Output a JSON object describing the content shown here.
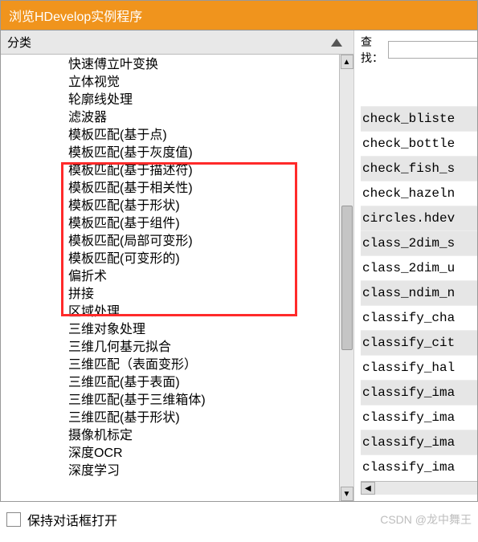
{
  "titlebar": {
    "title": "浏览HDevelop实例程序"
  },
  "left": {
    "header": "分类",
    "items": [
      "快速傅立叶变换",
      "立体视觉",
      "轮廓线处理",
      "滤波器",
      "模板匹配(基于点)",
      "模板匹配(基于灰度值)",
      "模板匹配(基于描述符)",
      "模板匹配(基于相关性)",
      "模板匹配(基于形状)",
      "模板匹配(基于组件)",
      "模板匹配(局部可变形)",
      "模板匹配(可变形的)",
      "偏折术",
      "拼接",
      "区域处理",
      "三维对象处理",
      "三维几何基元拟合",
      "三维匹配（表面变形）",
      "三维匹配(基于表面)",
      "三维匹配(基于三维箱体)",
      "三维匹配(基于形状)",
      "摄像机标定",
      "深度OCR",
      "深度学习"
    ]
  },
  "right": {
    "find_label": "查找：",
    "find_value": "",
    "results": [
      "check_bliste",
      "check_bottle",
      "check_fish_s",
      "check_hazeln",
      "circles.hdev",
      "class_2dim_s",
      "class_2dim_u",
      "class_ndim_n",
      "classify_cha",
      "classify_cit",
      "classify_hal",
      "classify_ima",
      "classify_ima",
      "classify_ima",
      "classify_ima"
    ]
  },
  "footer": {
    "keep_open": "保持对话框打开",
    "watermark": "CSDN @龙中舞王"
  },
  "icons": {
    "up": "▲",
    "down": "▼",
    "left": "◀",
    "right": "▶"
  }
}
